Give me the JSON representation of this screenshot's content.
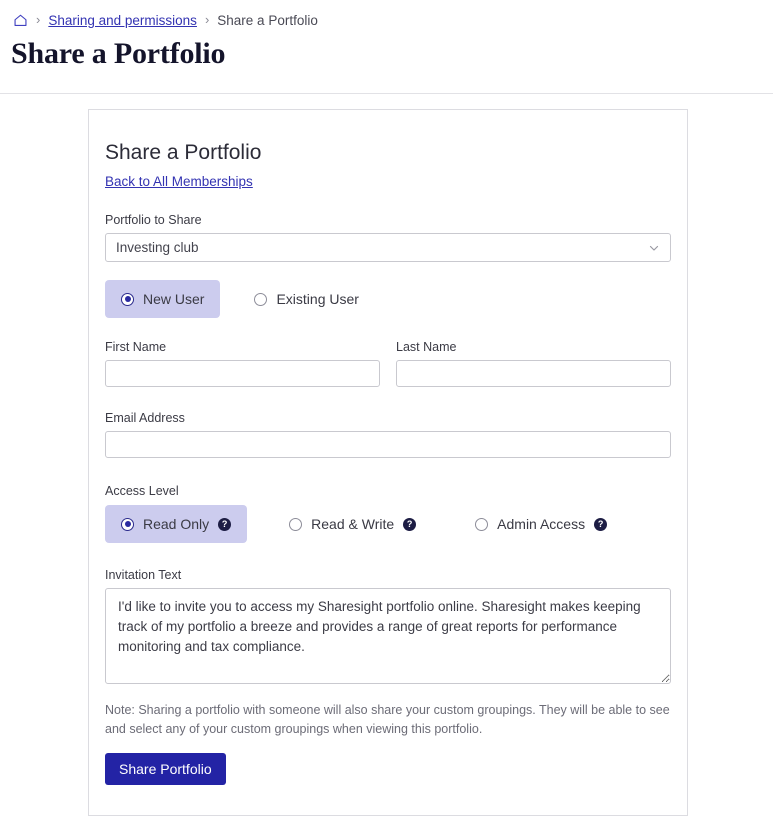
{
  "breadcrumb": {
    "home_icon": "home-icon",
    "separator": "›",
    "link_label": "Sharing and permissions",
    "current_label": "Share a Portfolio"
  },
  "page": {
    "title": "Share a Portfolio"
  },
  "card": {
    "title": "Share a Portfolio",
    "back_link": "Back to All Memberships",
    "portfolio": {
      "label": "Portfolio to Share",
      "selected": "Investing club",
      "caret_icon": "chevron-down-icon"
    },
    "user_type": {
      "options": [
        {
          "label": "New User",
          "selected": true
        },
        {
          "label": "Existing User",
          "selected": false
        }
      ]
    },
    "first_name": {
      "label": "First Name",
      "value": "",
      "placeholder": ""
    },
    "last_name": {
      "label": "Last Name",
      "value": "",
      "placeholder": ""
    },
    "email": {
      "label": "Email Address",
      "value": "",
      "placeholder": ""
    },
    "access_level": {
      "label": "Access Level",
      "help_glyph": "?",
      "options": [
        {
          "label": "Read Only",
          "selected": true,
          "help_icon": "help-icon"
        },
        {
          "label": "Read & Write",
          "selected": false,
          "help_icon": "help-icon"
        },
        {
          "label": "Admin Access",
          "selected": false,
          "help_icon": "help-icon"
        }
      ]
    },
    "invitation": {
      "label": "Invitation Text",
      "value": "I'd like to invite you to access my Sharesight portfolio online. Sharesight makes keeping track of my portfolio a breeze and provides a range of great reports for performance monitoring and tax compliance."
    },
    "note": "Note: Sharing a portfolio with someone will also share your custom groupings. They will be able to see and select any of your custom groupings when viewing this portfolio.",
    "submit_label": "Share Portfolio"
  },
  "colors": {
    "accent": "#2323a5",
    "link": "#3333b2",
    "selected_pill_bg": "#ccccee",
    "help_icon_bg": "#1d1d44",
    "title": "#14142b"
  }
}
